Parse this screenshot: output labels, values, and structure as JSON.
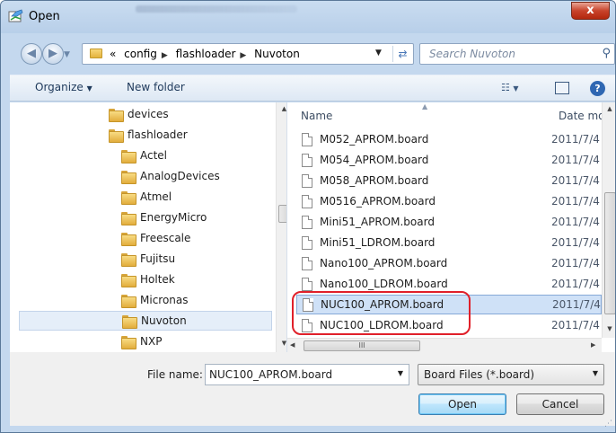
{
  "window": {
    "title": "Open",
    "close_label": "x"
  },
  "address": {
    "overflow": "«",
    "crumbs": [
      "config",
      "flashloader",
      "Nuvoton"
    ],
    "search_placeholder": "Search Nuvoton"
  },
  "toolbar": {
    "organize": "Organize",
    "new_folder": "New folder"
  },
  "nav_tree": [
    {
      "label": "devices",
      "level": 0,
      "selected": false
    },
    {
      "label": "flashloader",
      "level": 0,
      "selected": false
    },
    {
      "label": "Actel",
      "level": 1,
      "selected": false
    },
    {
      "label": "AnalogDevices",
      "level": 1,
      "selected": false
    },
    {
      "label": "Atmel",
      "level": 1,
      "selected": false
    },
    {
      "label": "EnergyMicro",
      "level": 1,
      "selected": false
    },
    {
      "label": "Freescale",
      "level": 1,
      "selected": false
    },
    {
      "label": "Fujitsu",
      "level": 1,
      "selected": false
    },
    {
      "label": "Holtek",
      "level": 1,
      "selected": false
    },
    {
      "label": "Micronas",
      "level": 1,
      "selected": false
    },
    {
      "label": "Nuvoton",
      "level": 1,
      "selected": true
    },
    {
      "label": "NXP",
      "level": 1,
      "selected": false
    }
  ],
  "files": {
    "col_name": "Name",
    "col_date": "Date mo",
    "rows": [
      {
        "name": "M052_APROM.board",
        "date": "2011/7/4",
        "selected": false
      },
      {
        "name": "M054_APROM.board",
        "date": "2011/7/4",
        "selected": false
      },
      {
        "name": "M058_APROM.board",
        "date": "2011/7/4",
        "selected": false
      },
      {
        "name": "M0516_APROM.board",
        "date": "2011/7/4",
        "selected": false
      },
      {
        "name": "Mini51_APROM.board",
        "date": "2011/7/4",
        "selected": false
      },
      {
        "name": "Mini51_LDROM.board",
        "date": "2011/7/4",
        "selected": false
      },
      {
        "name": "Nano100_APROM.board",
        "date": "2011/7/4",
        "selected": false
      },
      {
        "name": "Nano100_LDROM.board",
        "date": "2011/7/4",
        "selected": false
      },
      {
        "name": "NUC100_APROM.board",
        "date": "2011/7/4",
        "selected": true
      },
      {
        "name": "NUC100_LDROM.board",
        "date": "2011/7/4",
        "selected": false
      }
    ],
    "hscroll_grip": "III"
  },
  "bottom": {
    "filename_label": "File name:",
    "filename_value": "NUC100_APROM.board",
    "filetype_value": "Board Files (*.board)",
    "open_label": "Open",
    "cancel_label": "Cancel"
  },
  "colors": {
    "highlight": "#e0202a",
    "selection": "#cfe1f7"
  }
}
